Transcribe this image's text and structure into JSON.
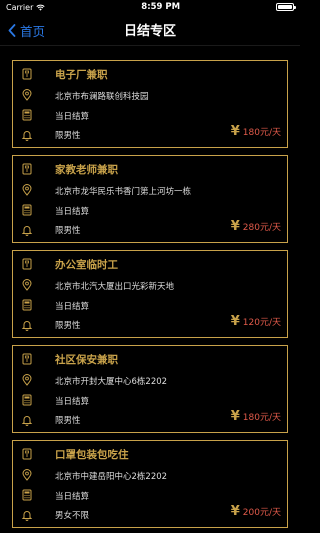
{
  "status": {
    "carrier": "Carrier",
    "time": "8:59 PM"
  },
  "nav": {
    "back_label": "首页",
    "title": "日结专区"
  },
  "jobs": [
    {
      "title": "电子厂兼职",
      "address": "北京市布澜路联创科技园",
      "settlement": "当日结算",
      "gender": "限男性",
      "price": "180元/天"
    },
    {
      "title": "家教老师兼职",
      "address": "北京市龙华民乐书香门第上河坊一栋",
      "settlement": "当日结算",
      "gender": "限男性",
      "price": "280元/天"
    },
    {
      "title": "办公室临时工",
      "address": "北京市北汽大厦出口光彩新天地",
      "settlement": "当日结算",
      "gender": "限男性",
      "price": "120元/天"
    },
    {
      "title": "社区保安兼职",
      "address": "北京市开封大厦中心6栋2202",
      "settlement": "当日结算",
      "gender": "限男性",
      "price": "180元/天"
    },
    {
      "title": "口罩包装包吃住",
      "address": "北京市中建岳阳中心2栋2202",
      "settlement": "当日结算",
      "gender": "男女不限",
      "price": "200元/天"
    }
  ],
  "colors": {
    "accent": "#c8a24a",
    "price": "#e05a4a",
    "link": "#2a78e4"
  }
}
